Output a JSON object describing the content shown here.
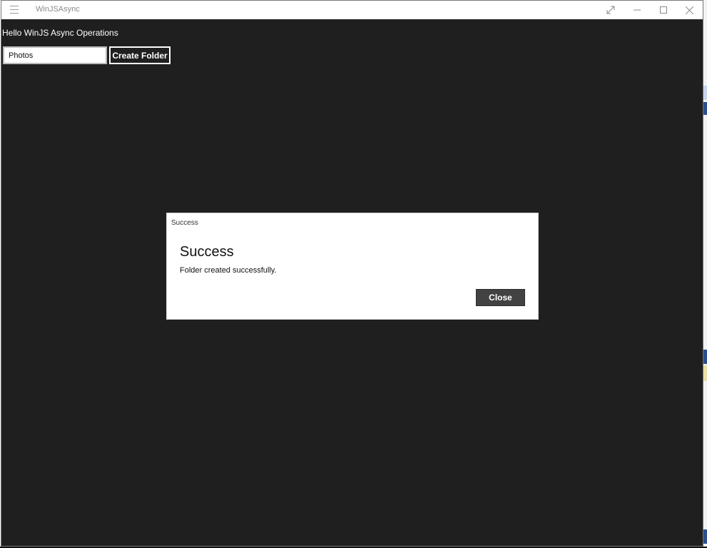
{
  "window": {
    "title": "WinJSAsync"
  },
  "main": {
    "heading": "Hello WinJS Async Operations",
    "folder_input_value": "Photos",
    "create_button_label": "Create Folder"
  },
  "dialog": {
    "caption": "Success",
    "title": "Success",
    "message": "Folder created successfully.",
    "close_button_label": "Close"
  },
  "icons": {
    "menu": "hamburger-menu-icon",
    "fullscreen": "expand-icon",
    "minimize": "minimize-icon",
    "maximize": "maximize-icon",
    "close": "close-icon"
  },
  "colors": {
    "app_background": "#1f1f1f",
    "titlebar_background": "#ffffff",
    "dialog_background": "#ffffff",
    "dialog_button": "#424242"
  }
}
